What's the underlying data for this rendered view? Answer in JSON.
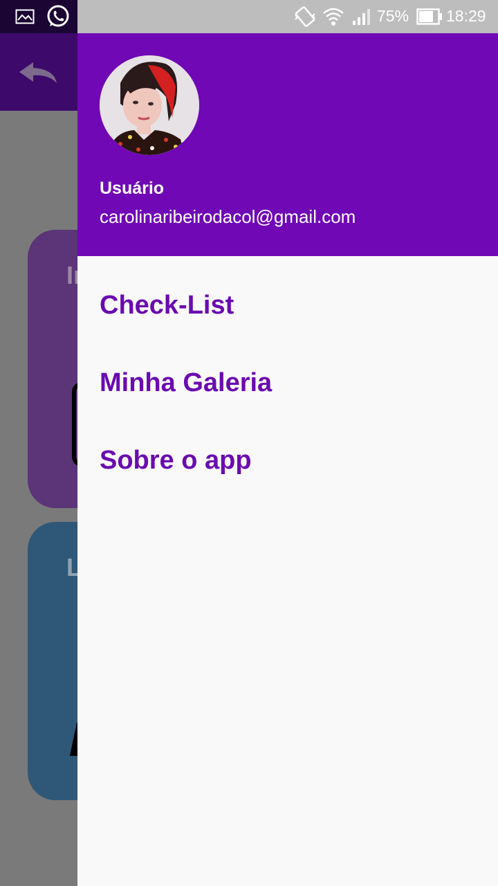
{
  "status_bar": {
    "battery": "75%",
    "time": "18:29",
    "icons": [
      "image-icon",
      "whatsapp-icon",
      "vibrate-icon",
      "wifi-icon",
      "signal-icon",
      "battery-icon"
    ]
  },
  "background_app": {
    "cards": [
      {
        "title": "In"
      },
      {
        "title": "L"
      }
    ]
  },
  "drawer": {
    "user": {
      "name": "Usuário",
      "email": "carolinaribeirodacol@gmail.com"
    },
    "menu": [
      {
        "label": "Check-List"
      },
      {
        "label": "Minha Galeria"
      },
      {
        "label": "Sobre o app"
      }
    ]
  },
  "colors": {
    "drawer_header": "#7008b5",
    "menu_text": "#6a0bb0"
  }
}
